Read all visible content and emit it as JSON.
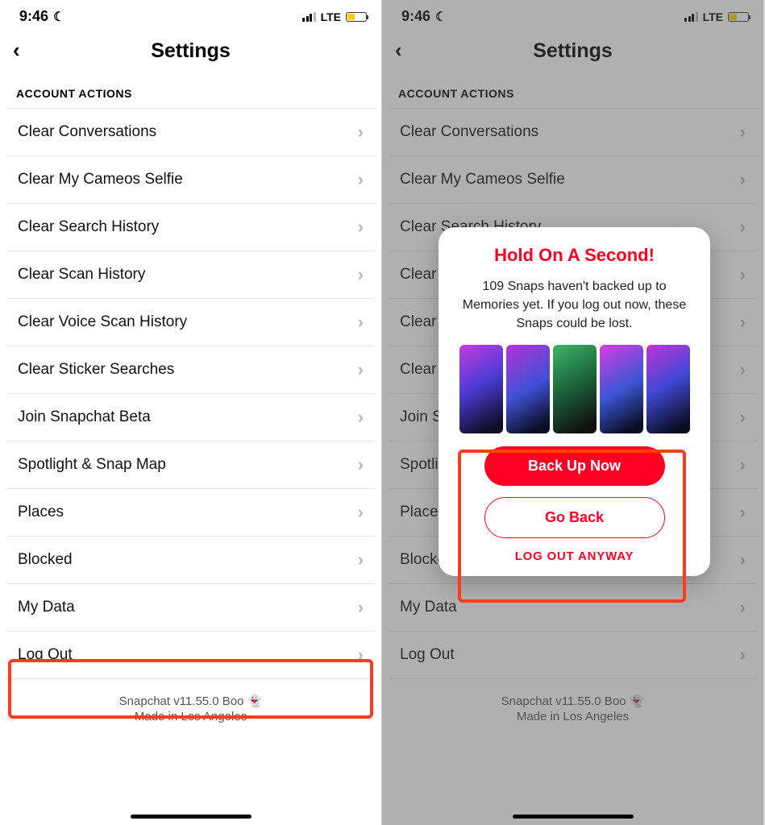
{
  "status": {
    "time": "9:46",
    "network": "LTE"
  },
  "header": {
    "title": "Settings",
    "section": "ACCOUNT ACTIONS"
  },
  "rows": [
    {
      "label": "Clear Conversations"
    },
    {
      "label": "Clear My Cameos Selfie"
    },
    {
      "label": "Clear Search History"
    },
    {
      "label": "Clear Scan History"
    },
    {
      "label": "Clear Voice Scan History"
    },
    {
      "label": "Clear Sticker Searches"
    },
    {
      "label": "Join Snapchat Beta"
    },
    {
      "label": "Spotlight & Snap Map"
    },
    {
      "label": "Places"
    },
    {
      "label": "Blocked"
    },
    {
      "label": "My Data"
    },
    {
      "label": "Log Out"
    }
  ],
  "footer": {
    "line1": "Snapchat v11.55.0 Boo 👻",
    "line2": "Made in Los Angeles"
  },
  "dialog": {
    "title": "Hold On A Second!",
    "message": "109 Snaps haven't backed up to Memories yet. If you log out now, these Snaps could be lost.",
    "primary": "Back Up Now",
    "secondary": "Go Back",
    "logout": "LOG OUT ANYWAY"
  }
}
